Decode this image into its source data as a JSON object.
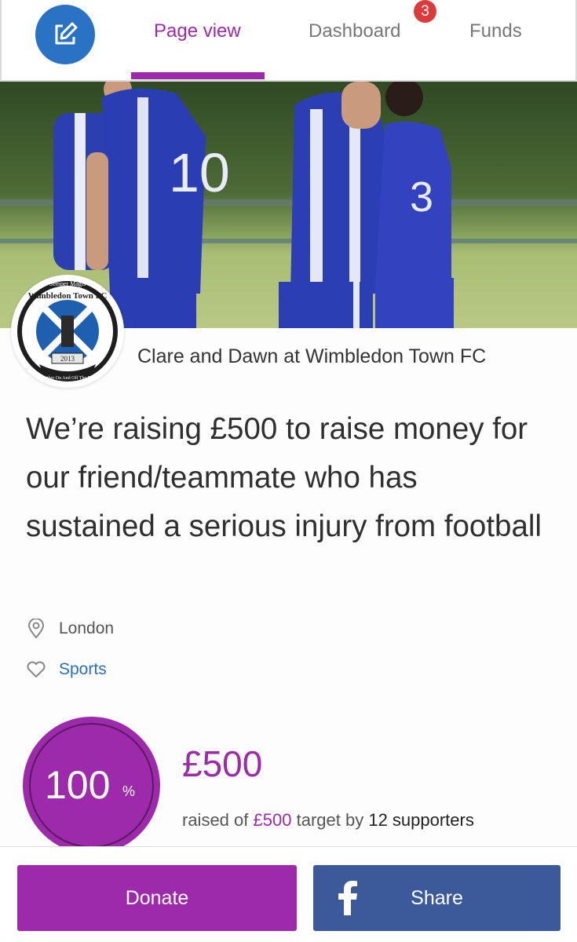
{
  "nav": {
    "tabs": [
      {
        "label": "Page view",
        "active": true
      },
      {
        "label": "Dashboard",
        "badge": "3"
      },
      {
        "label": "Funds"
      }
    ],
    "edit_icon": "edit-icon"
  },
  "hero": {
    "jersey_numbers": [
      "10",
      "3"
    ]
  },
  "logo": {
    "motto_top": "Semper Magis",
    "club_name": "Wimbledon Town FC",
    "year": "2013",
    "motto_bottom": "Together On And Off The Pitch"
  },
  "page": {
    "owner": "Clare and Dawn at Wimbledon Town FC",
    "headline": "We’re raising £500 to raise money for our friend/teammate who has sustained a serious injury from football",
    "location": "London",
    "category": "Sports"
  },
  "progress": {
    "percent": "100",
    "percent_sign": "%",
    "raised": "£500",
    "raised_prefix": "raised of",
    "target": "£500",
    "target_suffix": "target by",
    "supporters": "12 supporters"
  },
  "actions": {
    "donate_label": "Donate",
    "share_label": "Share"
  },
  "colors": {
    "brand_purple": "#9d2aaa",
    "edit_blue": "#2a72c3",
    "facebook_blue": "#3c5a9a",
    "badge_red": "#dc3b3b"
  }
}
